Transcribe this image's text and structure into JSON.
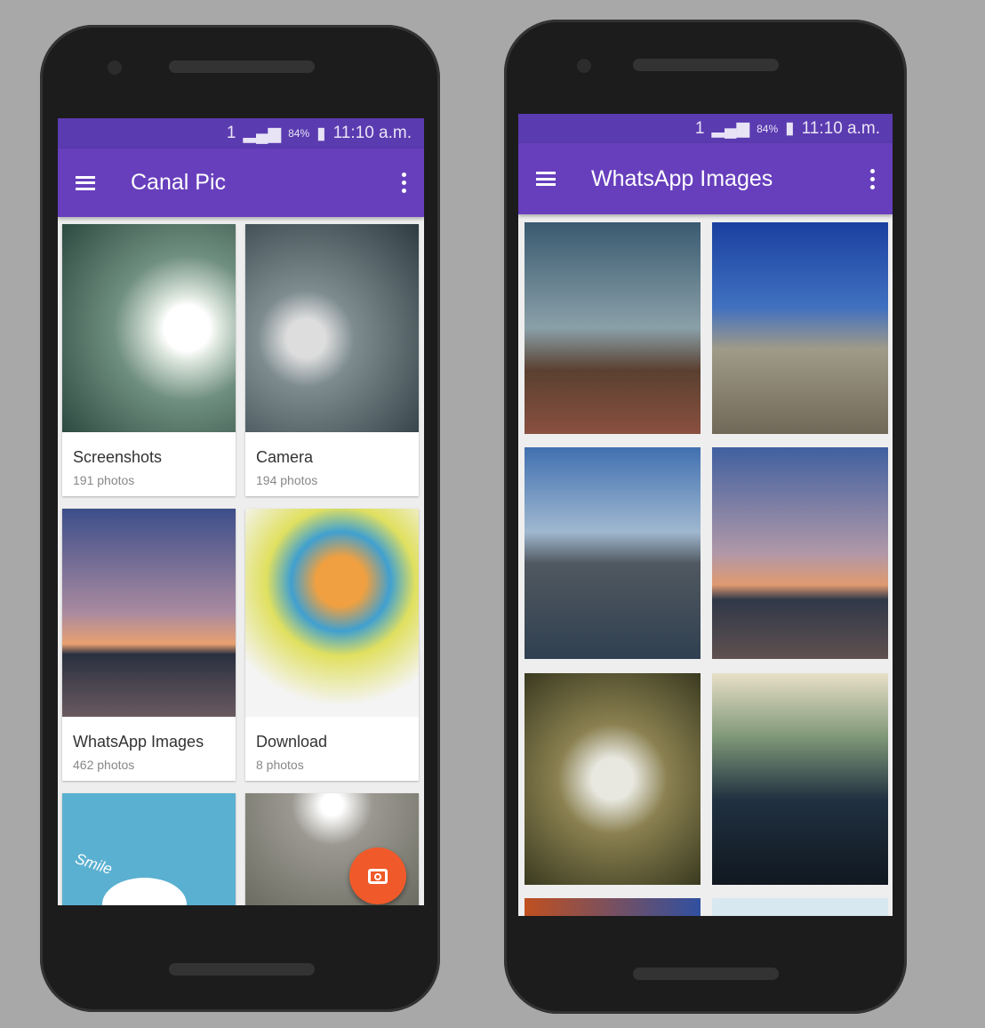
{
  "left_phone": {
    "status": {
      "sim": "1",
      "battery": "84%",
      "time": "11:10 a.m."
    },
    "app_title": "Canal Pic",
    "albums": [
      {
        "name": "Screenshots",
        "count": "191 photos"
      },
      {
        "name": "Camera",
        "count": "194 photos"
      },
      {
        "name": "WhatsApp Images",
        "count": "462 photos"
      },
      {
        "name": "Download",
        "count": "8 photos"
      }
    ],
    "partial_tile_text": "Smile",
    "fab_icon": "camera-icon",
    "colors": {
      "primary": "#673fbd",
      "status": "#5b3bb0",
      "fab": "#f05a2a"
    }
  },
  "right_phone": {
    "status": {
      "sim": "1",
      "battery": "84%",
      "time": "11:10 a.m."
    },
    "app_title": "WhatsApp Images"
  }
}
